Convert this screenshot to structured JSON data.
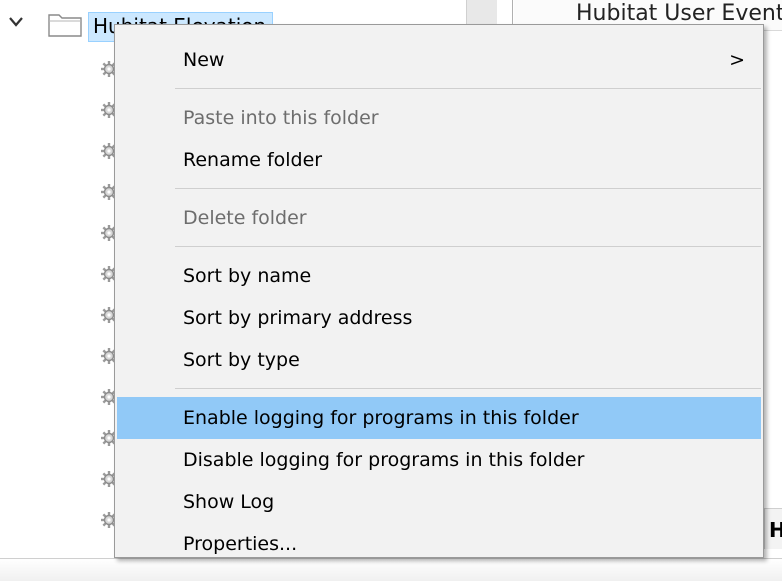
{
  "tree": {
    "folder_label": "Hubitat Elevation",
    "item_count": 12
  },
  "right_pane": {
    "header_text": "Hubitat User Event n",
    "bottom_fragment": "H"
  },
  "context_menu": {
    "highlight_color": "#91c9f7",
    "groups": [
      [
        {
          "label": "New",
          "state": "normal",
          "submenu": true,
          "submenu_glyph": ">"
        }
      ],
      [
        {
          "label": "Paste into this folder",
          "state": "disabled"
        },
        {
          "label": "Rename folder",
          "state": "normal"
        }
      ],
      [
        {
          "label": "Delete folder",
          "state": "disabled"
        }
      ],
      [
        {
          "label": "Sort by name",
          "state": "normal"
        },
        {
          "label": "Sort by primary address",
          "state": "normal"
        },
        {
          "label": "Sort by type",
          "state": "normal"
        }
      ],
      [
        {
          "label": "Enable logging for programs in this folder",
          "state": "highlighted"
        },
        {
          "label": "Disable logging for programs in this folder",
          "state": "normal"
        },
        {
          "label": "Show Log",
          "state": "normal"
        },
        {
          "label": "Properties...",
          "state": "normal"
        }
      ]
    ]
  }
}
